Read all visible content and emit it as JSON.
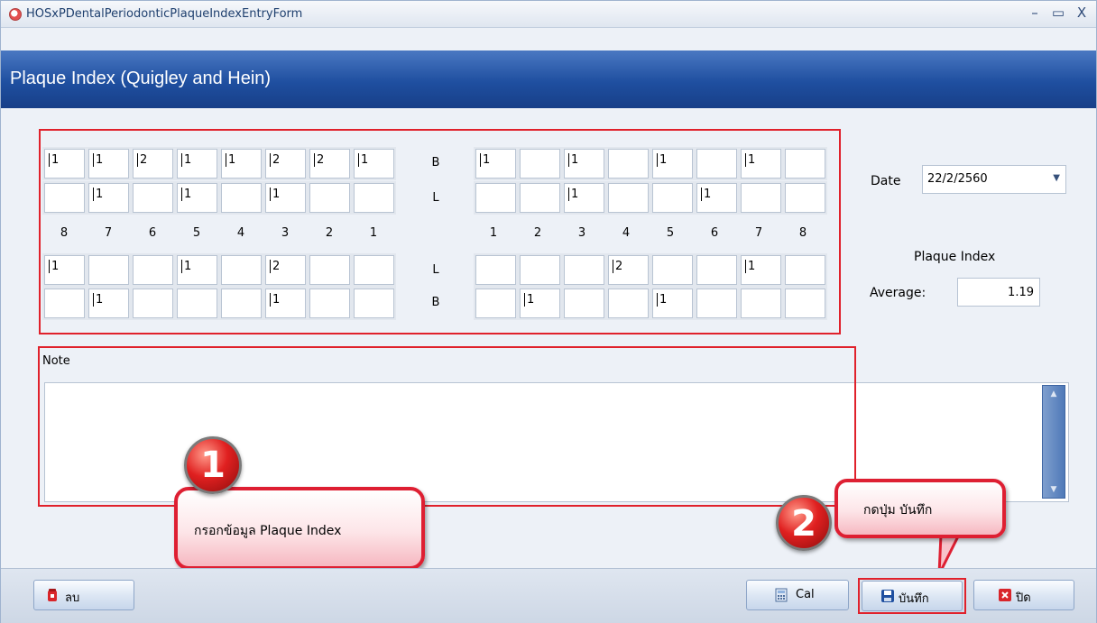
{
  "window": {
    "title": "HOSxPDentalPeriodonticPlaqueIndexEntryForm",
    "controls": {
      "minimize": "–",
      "maximize": "▭",
      "close": "X"
    }
  },
  "header": {
    "title": "Plaque Index (Quigley and Hein)"
  },
  "plaque_chart": {
    "upper_right_B": [
      "1",
      "1",
      "2",
      "1",
      "1",
      "2",
      "2",
      "1"
    ],
    "upper_right_L": [
      "",
      "1",
      "",
      "1",
      "",
      "1",
      "",
      ""
    ],
    "upper_left_B": [
      "1",
      "",
      "1",
      "",
      "1",
      "",
      "1",
      ""
    ],
    "upper_left_L": [
      "",
      "",
      "1",
      "",
      "",
      "1",
      "",
      ""
    ],
    "lower_right_L": [
      "1",
      "",
      "",
      "1",
      "",
      "2",
      "",
      ""
    ],
    "lower_right_B": [
      "",
      "1",
      "",
      "",
      "",
      "1",
      "",
      ""
    ],
    "lower_left_L": [
      "",
      "",
      "",
      "2",
      "",
      "",
      "1",
      ""
    ],
    "lower_left_B": [
      "",
      "1",
      "",
      "",
      "1",
      "",
      "",
      ""
    ],
    "row_labels": {
      "upper_B": "B",
      "upper_L": "L",
      "lower_L": "L",
      "lower_B": "B"
    },
    "right_tooth_numbers": [
      "8",
      "7",
      "6",
      "5",
      "4",
      "3",
      "2",
      "1"
    ],
    "left_tooth_numbers": [
      "1",
      "2",
      "3",
      "4",
      "5",
      "6",
      "7",
      "8"
    ]
  },
  "date": {
    "label": "Date",
    "value": "22/2/2560"
  },
  "plaque_index": {
    "label": "Plaque Index",
    "average_label": "Average:",
    "average_value": "1.19"
  },
  "note": {
    "label": "Note",
    "value": ""
  },
  "callouts": [
    {
      "number": "1",
      "text": "กรอกข้อมูล Plaque Index"
    },
    {
      "number": "2",
      "text": "กดปุ่ม บันทึก"
    }
  ],
  "buttons": {
    "delete": "ลบ",
    "cal": "Cal",
    "save": "บันทึก",
    "close": "ปิด"
  }
}
